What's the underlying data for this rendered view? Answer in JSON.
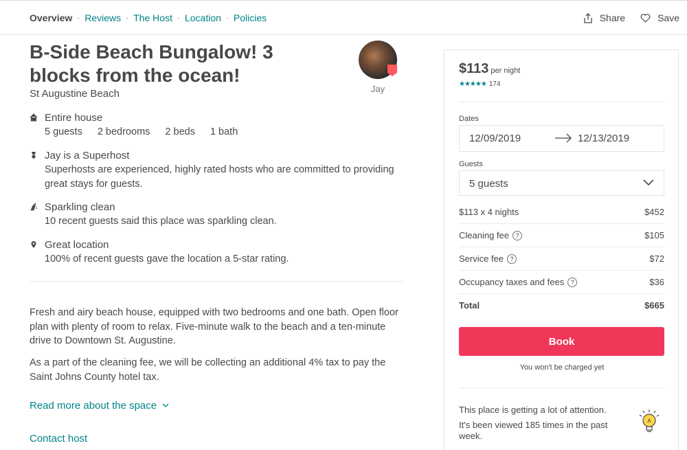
{
  "nav": {
    "items": [
      "Overview",
      "Reviews",
      "The Host",
      "Location",
      "Policies"
    ],
    "separator": "·",
    "share": "Share",
    "save": "Save"
  },
  "listing": {
    "title": "B-Side Beach Bungalow! 3 blocks from the ocean!",
    "city": "St Augustine Beach",
    "host_name": "Jay"
  },
  "features": {
    "house_title": "Entire house",
    "guests": "5 guests",
    "bedrooms": "2 bedrooms",
    "beds": "2 beds",
    "baths": "1 bath",
    "superhost_title": "Jay is a Superhost",
    "superhost_desc": "Superhosts are experienced, highly rated hosts who are committed to providing great stays for guests.",
    "clean_title": "Sparkling clean",
    "clean_desc": "10 recent guests said this place was sparkling clean.",
    "location_title": "Great location",
    "location_desc": "100% of recent guests gave the location a 5-star rating."
  },
  "description": {
    "p1": "Fresh and airy beach house, equipped with two bedrooms and one bath. Open floor plan with plenty of room to relax. Five-minute walk to the beach and a ten-minute drive to Downtown St. Augustine.",
    "p2": "As a part of the cleaning fee, we will be collecting an additional 4% tax to pay the Saint Johns County hotel tax.",
    "read_more": "Read more about the space",
    "contact": "Contact host"
  },
  "booking": {
    "price": "$113",
    "per_night": "per night",
    "stars": "★★★★★",
    "review_count": "174",
    "dates_label": "Dates",
    "check_in": "12/09/2019",
    "check_out": "12/13/2019",
    "guests_label": "Guests",
    "guests_value": "5 guests",
    "nights_label": "$113 x 4 nights",
    "nights_value": "$452",
    "cleaning_label": "Cleaning fee",
    "cleaning_value": "$105",
    "service_label": "Service fee",
    "service_value": "$72",
    "taxes_label": "Occupancy taxes and fees",
    "taxes_value": "$36",
    "help_glyph": "?",
    "total_label": "Total",
    "total_value": "$665",
    "book_label": "Book",
    "no_charge": "You won't be charged yet",
    "attention_title": "This place is getting a lot of attention.",
    "attention_desc": "It's been viewed 185 times in the past week."
  },
  "colors": {
    "accent": "#008489",
    "book": "#f0375a",
    "text": "#484848"
  }
}
